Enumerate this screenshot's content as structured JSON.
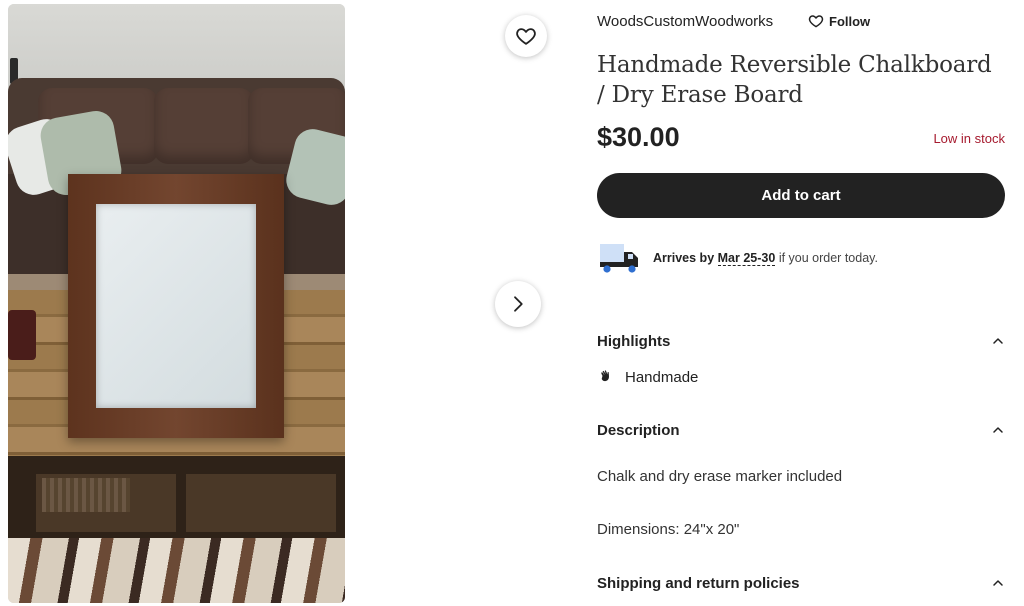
{
  "shop": {
    "name": "WoodsCustomWoodworks",
    "follow_label": "Follow"
  },
  "listing": {
    "title": "Handmade Reversible Chalkboard / Dry Erase Board",
    "price": "$30.00",
    "stock_status": "Low in stock",
    "add_to_cart_label": "Add to cart"
  },
  "delivery": {
    "arrives_prefix": "Arrives by",
    "date_range": "Mar 25-30",
    "suffix": "if you order today."
  },
  "highlights": {
    "heading": "Highlights",
    "items": [
      {
        "icon": "hand-icon",
        "label": "Handmade"
      }
    ]
  },
  "description": {
    "heading": "Description",
    "lines": [
      "Chalk and dry erase marker included",
      "Dimensions: 24\"x 20\""
    ]
  },
  "shipping": {
    "heading": "Shipping and return policies"
  },
  "colors": {
    "accent_dark": "#222222",
    "low_stock": "#a61a2e"
  }
}
